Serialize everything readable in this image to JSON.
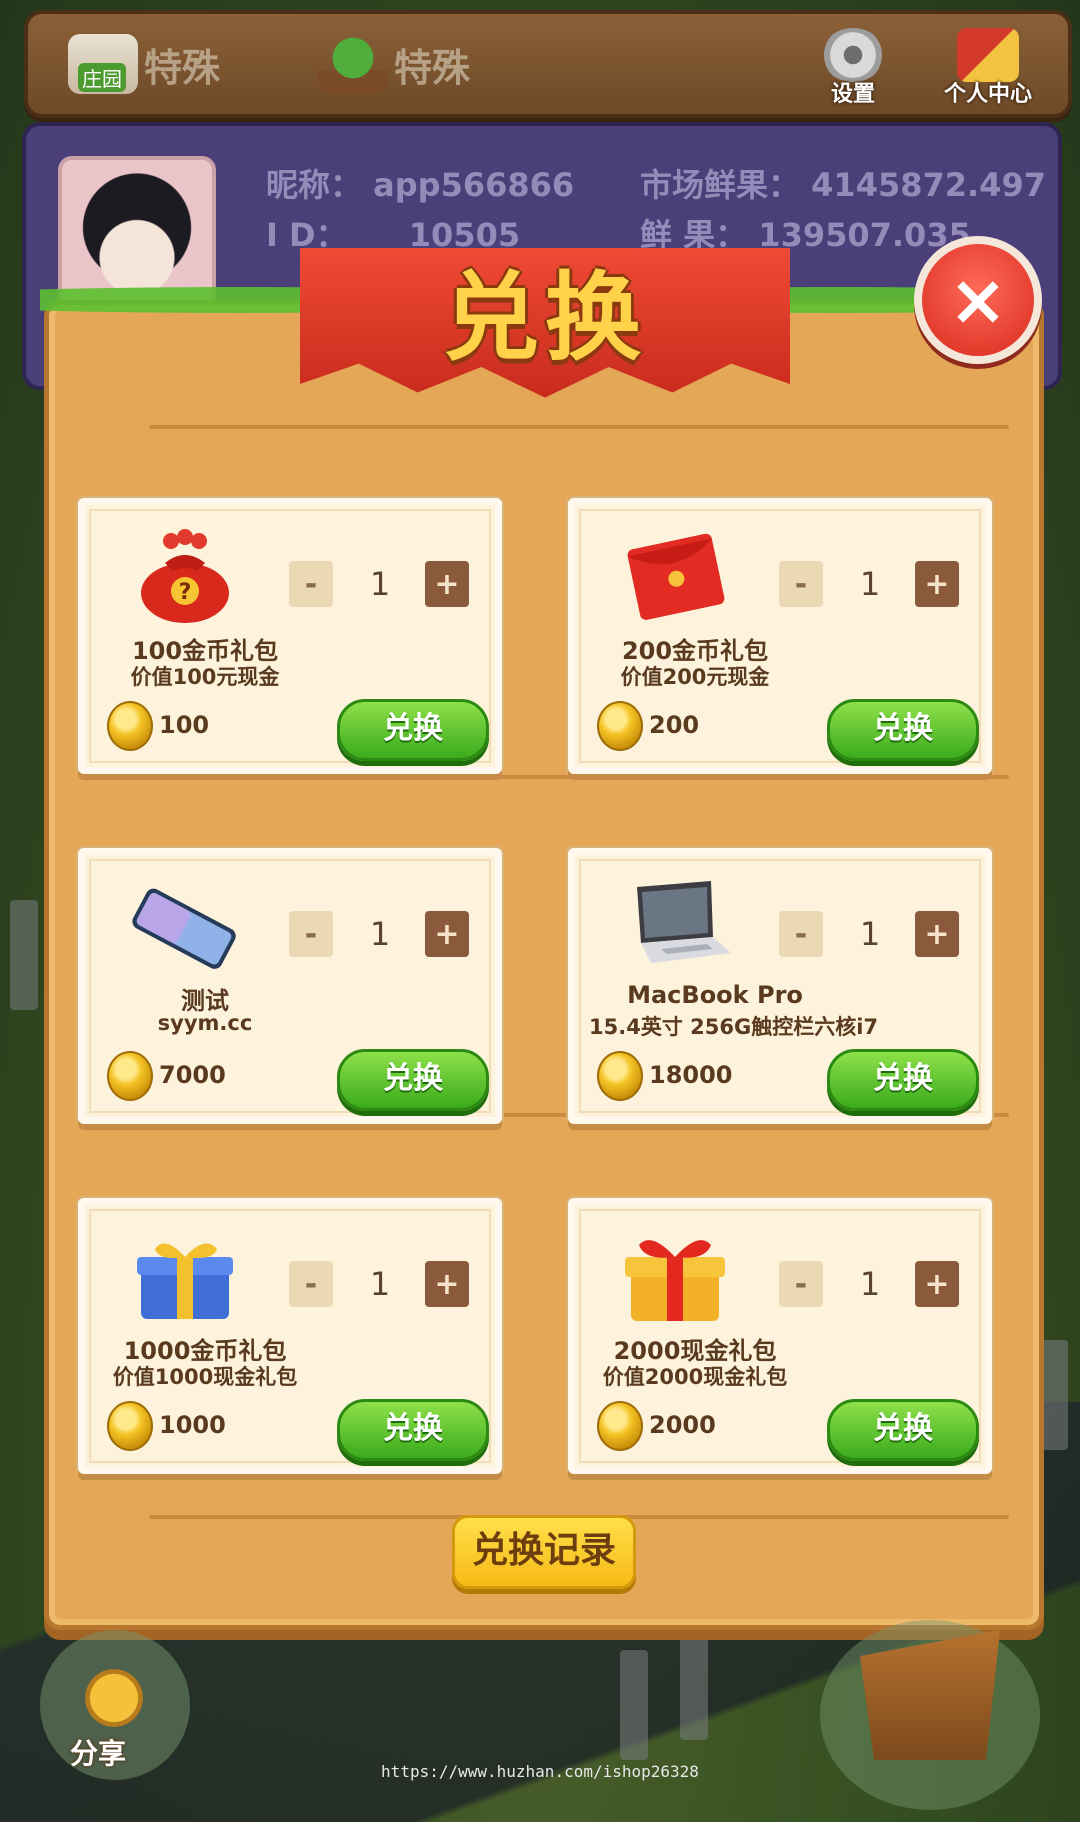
{
  "top_bar": {
    "tab1_label": "特殊",
    "tab2_label": "特殊",
    "settings_label": "设置",
    "profile_label": "个人中心"
  },
  "player": {
    "nickname_label": "昵称：",
    "nickname": "app566866",
    "id_label": "I D：",
    "id": "10505",
    "market_label": "市场鲜果：",
    "market_value": "4145872.497",
    "fruit_label": "鲜    果：",
    "fruit_value": "139507.035"
  },
  "dialog": {
    "title": "兑换",
    "close_icon": "×",
    "history_label": "兑换记录"
  },
  "items": [
    {
      "name": "100金币礼包",
      "desc": "价值100元现金",
      "price": "100",
      "qty": "1",
      "icon": "money-bag-icon",
      "button": "兑换"
    },
    {
      "name": "200金币礼包",
      "desc": "价值200元现金",
      "price": "200",
      "qty": "1",
      "icon": "red-envelope-icon",
      "button": "兑换"
    },
    {
      "name": "测试",
      "desc": "syym.cc",
      "price": "7000",
      "qty": "1",
      "icon": "phone-icon",
      "button": "兑换"
    },
    {
      "name": "MacBook Pro",
      "desc": "15.4英寸 256G触控栏六核i7",
      "price": "18000",
      "qty": "1",
      "icon": "laptop-icon",
      "button": "兑换"
    },
    {
      "name": "1000金币礼包",
      "desc": "价值1000现金礼包",
      "price": "1000",
      "qty": "1",
      "icon": "blue-gift-icon",
      "button": "兑换"
    },
    {
      "name": "2000现金礼包",
      "desc": "价值2000现金礼包",
      "price": "2000",
      "qty": "1",
      "icon": "gold-gift-icon",
      "button": "兑换"
    }
  ],
  "qty_minus": "-",
  "qty_plus": "+",
  "bottom": {
    "share_label": "分享"
  },
  "watermark": "https://www.huzhan.com/ishop26328"
}
